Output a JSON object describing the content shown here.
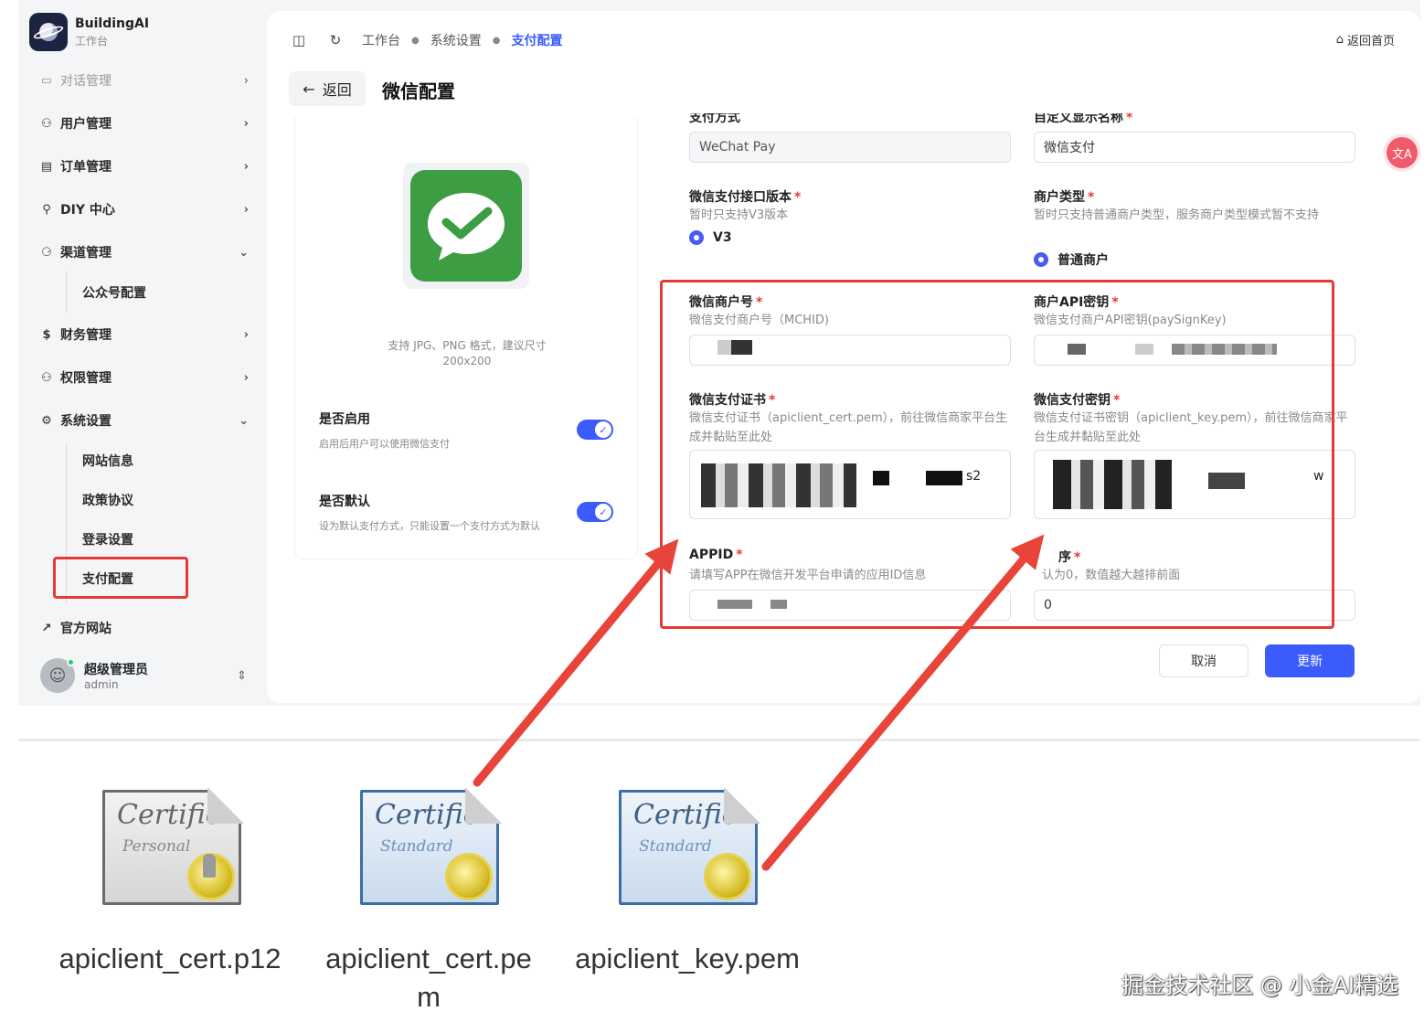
{
  "brand": {
    "name": "BuildingAI",
    "subtitle": "工作台"
  },
  "sidebar": {
    "items": [
      {
        "label": "对话管理",
        "icon": "chat-icon"
      },
      {
        "label": "用户管理",
        "icon": "users-icon"
      },
      {
        "label": "订单管理",
        "icon": "order-icon"
      },
      {
        "label": "DIY 中心",
        "icon": "diy-icon"
      },
      {
        "label": "渠道管理",
        "icon": "channel-icon"
      },
      {
        "label": "财务管理",
        "icon": "finance-icon"
      },
      {
        "label": "权限管理",
        "icon": "permission-icon"
      },
      {
        "label": "系统设置",
        "icon": "settings-icon"
      },
      {
        "label": "官方网站",
        "icon": "external-link-icon"
      }
    ],
    "channel_sub": [
      "公众号配置"
    ],
    "settings_sub": [
      "网站信息",
      "政策协议",
      "登录设置",
      "支付配置"
    ]
  },
  "user": {
    "name": "超级管理员",
    "role": "admin"
  },
  "breadcrumb": [
    "工作台",
    "系统设置",
    "支付配置"
  ],
  "home_link": "返回首页",
  "back_label": "返回",
  "page_title": "微信配置",
  "upload_hint": [
    "支持 JPG、PNG 格式，建议尺寸",
    "200x200"
  ],
  "toggles": [
    {
      "title": "是否启用",
      "desc": "启用后用户可以使用微信支付",
      "on": true
    },
    {
      "title": "是否默认",
      "desc": "设为默认支付方式，只能设置一个支付方式为默认",
      "on": true
    }
  ],
  "form": {
    "pay_method_label": "支付方式",
    "pay_method_value": "WeChat Pay",
    "display_name_label": "自定义显示名称",
    "display_name_value": "微信支付",
    "api_version_label": "微信支付接口版本",
    "api_version_desc": "暂时只支持V3版本",
    "api_version_option": "V3",
    "merchant_type_label": "商户类型",
    "merchant_type_desc": "暂时只支持普通商户类型，服务商户类型模式暂不支持",
    "merchant_type_option": "普通商户",
    "mchid_label": "微信商户号",
    "mchid_desc": "微信支付商户号（MCHID)",
    "api_key_label": "商户API密钥",
    "api_key_desc": "微信支付商户API密钥(paySignKey)",
    "cert_label": "微信支付证书",
    "cert_desc": "微信支付证书（apiclient_cert.pem），前往微信商家平台生成并黏贴至此处",
    "cert_fragment": "s2",
    "key_label": "微信支付密钥",
    "key_desc": "微信支付证书密钥（apiclient_key.pem），前往微信商家平台生成并黏贴至此处",
    "key_fragment": "w",
    "appid_label": "APPID",
    "appid_desc": "请填写APP在微信开发平台申请的应用ID信息",
    "sort_label": "序",
    "sort_desc": "认为0，数值越大越排前面",
    "sort_value": "0"
  },
  "buttons": {
    "cancel": "取消",
    "update": "更新"
  },
  "translate_fab": "文A",
  "cert_files": [
    {
      "name_line1": "apiclient_cert.p12",
      "name_line2": "",
      "kind": "Personal"
    },
    {
      "name_line1": "apiclient_cert.pe",
      "name_line2": "m",
      "kind": "Standard"
    },
    {
      "name_line1": "apiclient_key.pem",
      "name_line2": "",
      "kind": "Standard"
    }
  ],
  "cert_script": "Certificate",
  "watermark": "掘金技术社区 @ 小金AI精选",
  "colors": {
    "accent": "#3b5bfd",
    "highlight": "#e53935",
    "wechat_green": "#3d9d42"
  }
}
